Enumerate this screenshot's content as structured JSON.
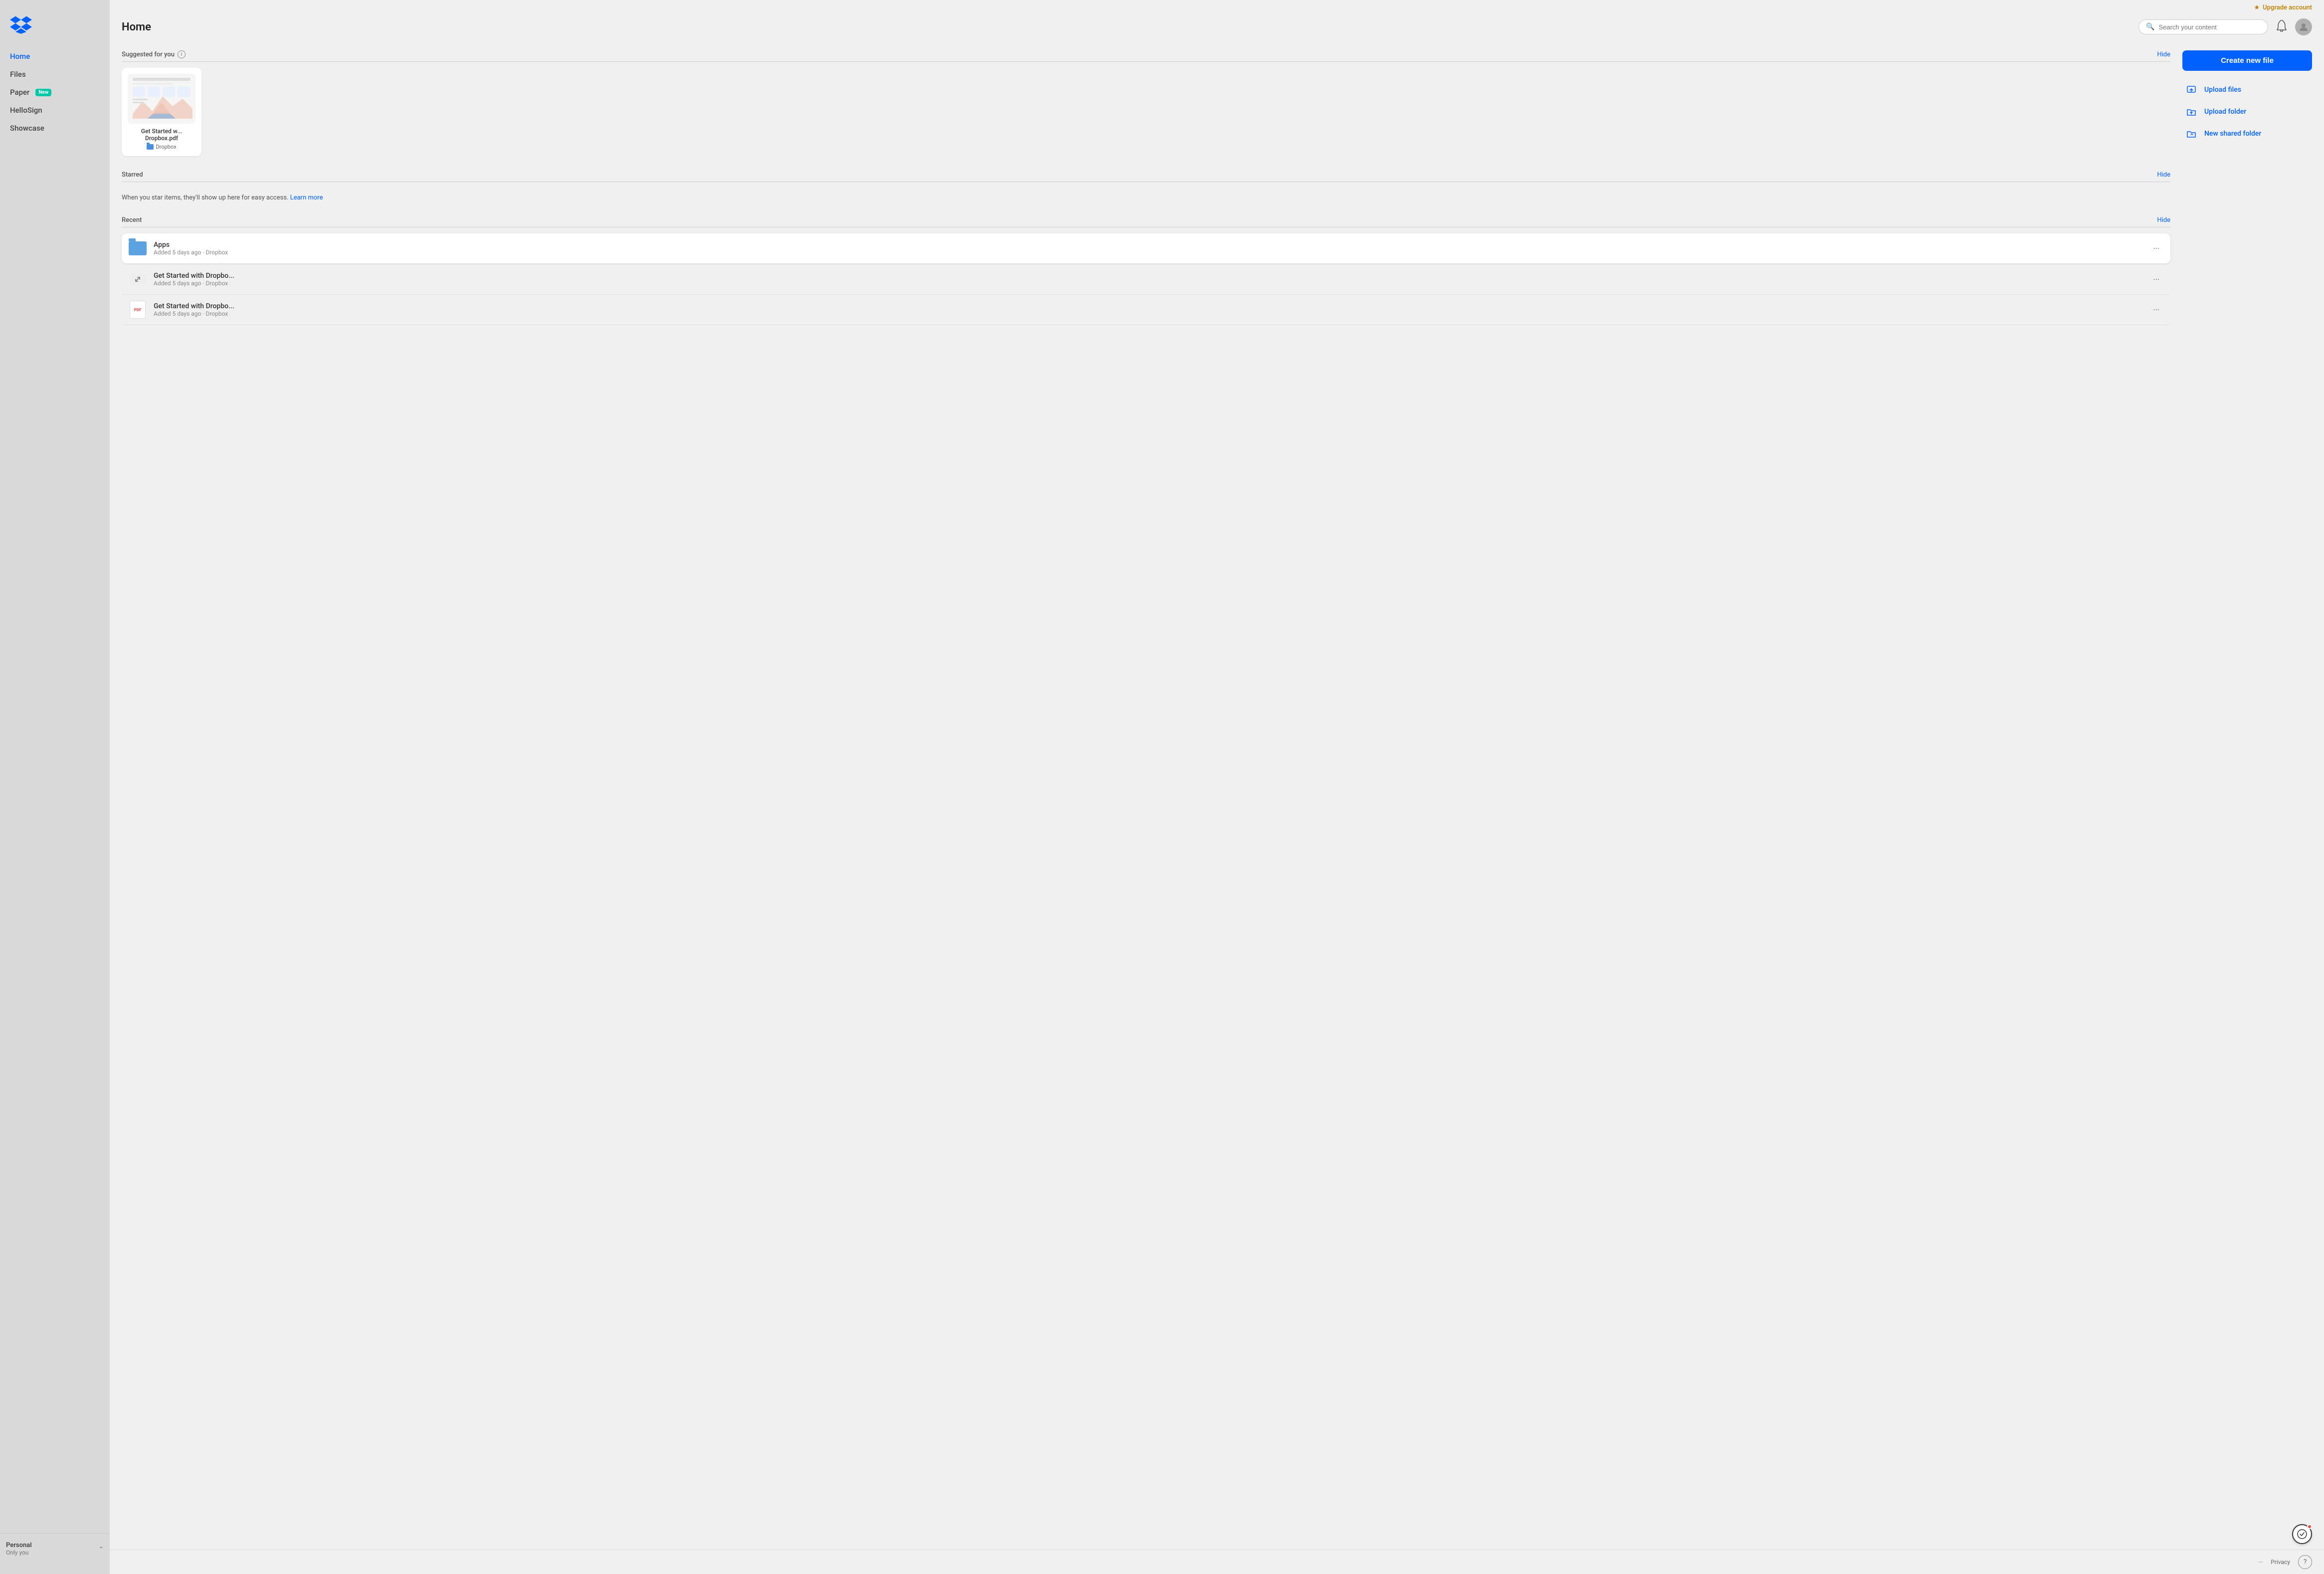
{
  "upgrade": {
    "label": "Upgrade account"
  },
  "header": {
    "title": "Home",
    "search_placeholder": "Search your content"
  },
  "sidebar": {
    "logo_alt": "Dropbox logo",
    "items": [
      {
        "id": "home",
        "label": "Home",
        "active": true
      },
      {
        "id": "files",
        "label": "Files",
        "active": false
      },
      {
        "id": "paper",
        "label": "Paper",
        "active": false,
        "badge": "New"
      },
      {
        "id": "hellosign",
        "label": "HelloSign",
        "active": false
      },
      {
        "id": "showcase",
        "label": "Showcase",
        "active": false
      }
    ],
    "footer": {
      "title": "Personal",
      "subtitle": "Only you"
    }
  },
  "suggested": {
    "section_title": "Suggested for you",
    "hide_label": "Hide",
    "card": {
      "name": "Get Started w... Dropbox.pdf",
      "folder": "Dropbox"
    }
  },
  "starred": {
    "section_title": "Starred",
    "hide_label": "Hide",
    "empty_text": "When you star items, they'll show up here for easy access.",
    "learn_more": "Learn more"
  },
  "recent": {
    "section_title": "Recent",
    "hide_label": "Hide",
    "items": [
      {
        "id": "apps",
        "type": "folder",
        "name": "Apps",
        "meta": "Added 5 days ago · Dropbox",
        "highlighted": true
      },
      {
        "id": "get-started-link",
        "type": "link",
        "name": "Get Started with Dropbo...",
        "meta": "Added 5 days ago · Dropbox",
        "highlighted": false
      },
      {
        "id": "get-started-pdf",
        "type": "pdf",
        "name": "Get Started with Dropbo...",
        "meta": "Added 5 days ago · Dropbox",
        "highlighted": false
      }
    ]
  },
  "actions": {
    "create_label": "Create new file",
    "upload_files_label": "Upload files",
    "upload_folder_label": "Upload folder",
    "new_shared_folder_label": "New shared folder"
  },
  "bottom": {
    "more_label": "···",
    "privacy_label": "Privacy",
    "help_label": "?"
  },
  "colors": {
    "accent": "#0061fe",
    "folder_blue": "#5ba3e0",
    "badge_green": "#00c9a7"
  }
}
